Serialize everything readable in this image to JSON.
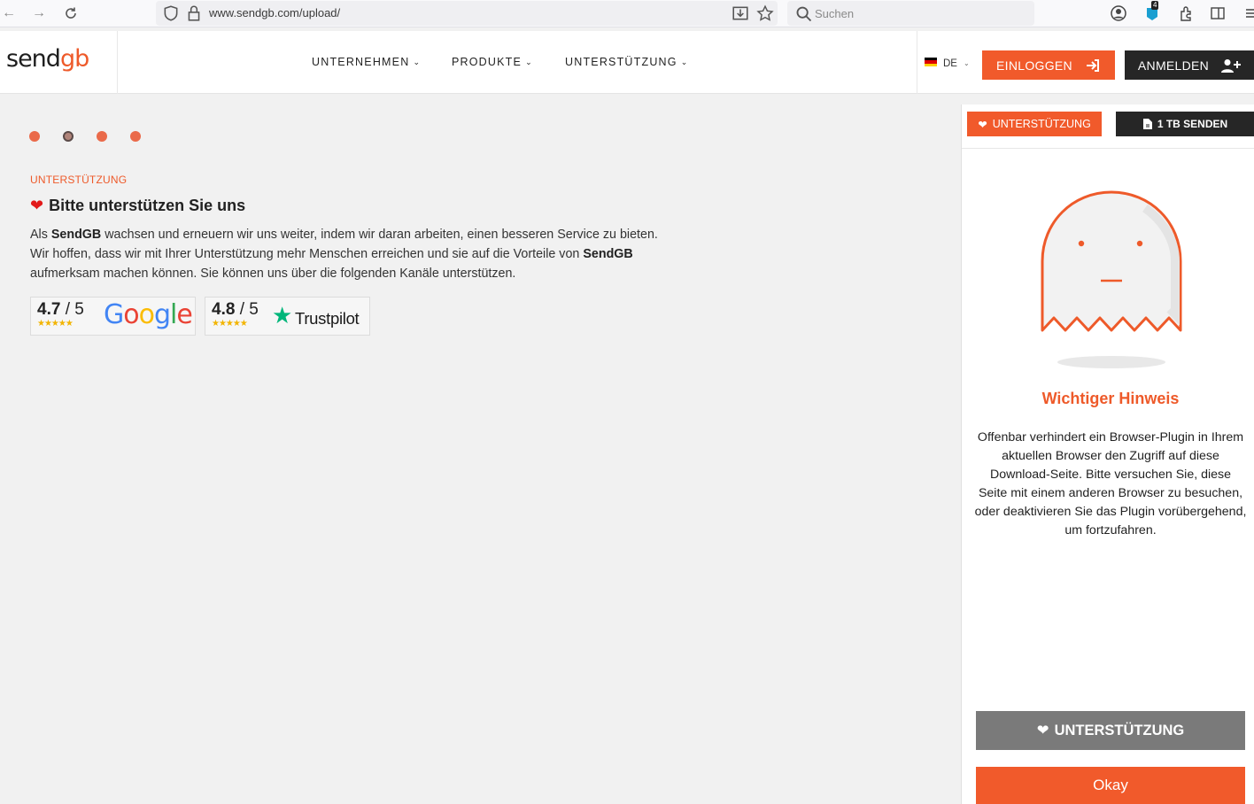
{
  "browser": {
    "url": "www.sendgb.com/upload/",
    "search_placeholder": "Suchen",
    "extension_badge": "4"
  },
  "header": {
    "logo_send": "send",
    "logo_gb": "gb",
    "menu": [
      {
        "label": "UNTERNEHMEN"
      },
      {
        "label": "PRODUKTE"
      },
      {
        "label": "UNTERSTÜTZUNG"
      }
    ],
    "language": "DE",
    "login_label": "EINLOGGEN",
    "register_label": "ANMELDEN"
  },
  "main": {
    "section_label": "UNTERSTÜTZUNG",
    "title": "Bitte unterstützen Sie uns",
    "body_parts": {
      "p1": "Als ",
      "b1": "SendGB",
      "p2": " wachsen und erneuern wir uns weiter, indem wir daran arbeiten, einen besseren Service zu bieten. Wir hoffen, dass wir mit Ihrer Unterstützung mehr Menschen erreichen und sie auf die Vorteile von ",
      "b2": "SendGB",
      "p3": " aufmerksam machen können. Sie können uns über die folgenden Kanäle unterstützen."
    },
    "ratings": [
      {
        "score": "4.7",
        "max": "/ 5",
        "stars": "★★★★★",
        "brand": "Google"
      },
      {
        "score": "4.8",
        "max": "/ 5",
        "stars": "★★★★★",
        "brand": "Trustpilot"
      }
    ]
  },
  "panel": {
    "tab_support": "UNTERSTÜTZUNG",
    "tab_send": "1 TB SENDEN",
    "notice_title": "Wichtiger Hinweis",
    "notice_text": "Offenbar verhindert ein Browser-Plugin in Ihrem aktuellen Browser den Zugriff auf diese Download-Seite. Bitte versuchen Sie, diese Seite mit einem anderen Browser zu besuchen, oder deaktivieren Sie das Plugin vorübergehend, um fortzufahren.",
    "support_button": "UNTERSTÜTZUNG",
    "okay_button": "Okay"
  },
  "colors": {
    "brand": "#f15a2b",
    "dark": "#262626",
    "gray_button": "#7a7a7a"
  }
}
